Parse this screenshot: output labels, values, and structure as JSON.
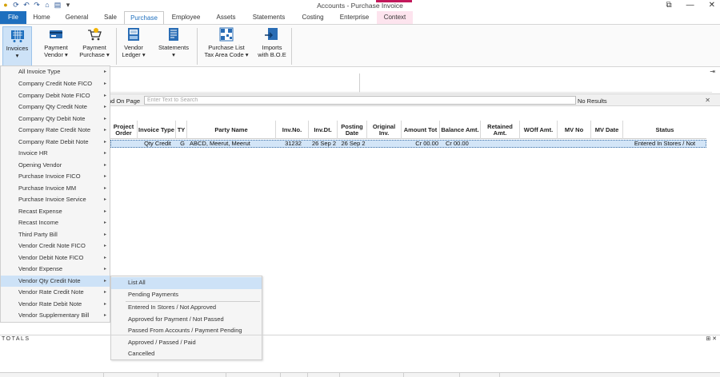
{
  "window": {
    "title": "Accounts - Purchase Invoice"
  },
  "tabs": [
    {
      "label": "File"
    },
    {
      "label": "Home"
    },
    {
      "label": "General"
    },
    {
      "label": "Sale"
    },
    {
      "label": "Purchase"
    },
    {
      "label": "Employee"
    },
    {
      "label": "Assets"
    },
    {
      "label": "Statements"
    },
    {
      "label": "Costing"
    },
    {
      "label": "Enterprise"
    },
    {
      "label": "Context"
    }
  ],
  "ribbon": {
    "invoices": {
      "line1": "Invoices",
      "line2": ""
    },
    "payment_vendor": {
      "line1": "Payment",
      "line2": "Vendor"
    },
    "payment_purchase": {
      "line1": "Payment",
      "line2": "Purchase"
    },
    "vendor_ledger": {
      "line1": "Vendor",
      "line2": "Ledger"
    },
    "statements": {
      "line1": "Statements",
      "line2": ""
    },
    "purchase_list": {
      "line1": "Purchase List",
      "line2": "Tax Area Code"
    },
    "imports": {
      "line1": "Imports",
      "line2": "with B.O.E"
    }
  },
  "find": {
    "label": "nd On Page",
    "placeholder": "Enter Text to Search",
    "result": "No Results"
  },
  "grid": {
    "headers": [
      "Project Order",
      "Invoice Type",
      "TY",
      "Party Name",
      "Inv.No.",
      "Inv.Dt.",
      "Posting Date",
      "Original Inv.",
      "Amount Tot",
      "Balance Amt.",
      "Retained Amt.",
      "WOff Amt.",
      "MV No",
      "MV Date",
      "Status"
    ],
    "rows": [
      [
        "",
        "Qty Credit",
        "G",
        "ABCD, Meerut, Meerut",
        "31232",
        "26 Sep 2",
        "26 Sep 2",
        "",
        "Cr 00.00",
        "Cr 00.00",
        "",
        "",
        "",
        "",
        "Entered In Stores / Not"
      ]
    ]
  },
  "menu": {
    "items": [
      {
        "label": "All Invoice Type"
      },
      {
        "label": "Company Credit Note FICO"
      },
      {
        "label": "Company Debit Note FICO"
      },
      {
        "label": "Company Qty Credit Note"
      },
      {
        "label": "Company Qty Debit Note"
      },
      {
        "label": "Company Rate Credit Note"
      },
      {
        "label": "Company Rate Debit Note"
      },
      {
        "label": "Invoice HR"
      },
      {
        "label": "Opening Vendor"
      },
      {
        "label": "Purchase Invoice FICO"
      },
      {
        "label": "Purchase Invoice MM"
      },
      {
        "label": "Purchase Invoice Service"
      },
      {
        "label": "Recast Expense"
      },
      {
        "label": "Recast Income"
      },
      {
        "label": "Third Party Bill"
      },
      {
        "label": "Vendor Credit Note FICO"
      },
      {
        "label": "Vendor Debit Note FICO"
      },
      {
        "label": "Vendor Expense"
      },
      {
        "label": "Vendor Qty Credit Note"
      },
      {
        "label": "Vendor Rate Credit Note"
      },
      {
        "label": "Vendor Rate Debit Note"
      },
      {
        "label": "Vendor Supplementary Bill"
      }
    ],
    "arrow": "▸"
  },
  "submenu": {
    "items": [
      {
        "label": "List All"
      },
      {
        "label": "Pending Payments"
      },
      {
        "label": "Entered In Stores / Not Approved"
      },
      {
        "label": "Approved for Payment / Not Passed"
      },
      {
        "label": "Passed From Accounts / Payment Pending"
      },
      {
        "label": "Approved / Passed / Paid"
      },
      {
        "label": "Cancelled"
      }
    ]
  },
  "totals": {
    "label": "TOTALS",
    "controls": "⊞ ✕"
  },
  "icons": {
    "pin": "⇥",
    "filter": "✕",
    "minimize": "—",
    "restore": "⧉",
    "close": "✕"
  },
  "colors": {
    "accent": "#1e6fbe",
    "selection": "#cde2f7",
    "context_tab": "#fde4ee"
  }
}
